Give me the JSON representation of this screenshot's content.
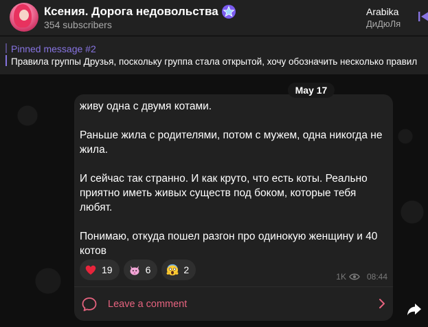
{
  "header": {
    "title": "Ксения. Дорога недовольства",
    "subscribers": "354 subscribers"
  },
  "audio": {
    "title": "Arabika",
    "artist": "ДиДюЛя"
  },
  "pinned": {
    "label": "Pinned message #2",
    "text": "Правила группы Друзья, поскольку группа стала открытой, хочу обозначить несколько правил"
  },
  "date_chip": "May 17",
  "message": {
    "paragraphs": [
      "живу одна с двумя котами.",
      "Раньше жила с родителями, потом с мужем, одна никогда не жила.",
      "И сейчас так странно. И как круто, что есть коты. Реально приятно иметь живых существ под боком, которые тебя любят.",
      "Понимаю, откуда пошел разгон про одинокую женщину и 40 котов"
    ],
    "reactions": [
      {
        "emoji": "heart",
        "count": "19"
      },
      {
        "emoji": "cat",
        "count": "6"
      },
      {
        "emoji": "scream",
        "count": "2"
      }
    ],
    "views": "1K",
    "time": "08:44",
    "comment_label": "Leave a comment"
  },
  "colors": {
    "accent": "#8774e1",
    "comment": "#e6637f",
    "bubble": "#212121"
  },
  "icons": [
    "star-badge-icon",
    "audio-play-icon",
    "eye-icon",
    "comment-icon",
    "chevron-right-icon",
    "forward-icon"
  ]
}
